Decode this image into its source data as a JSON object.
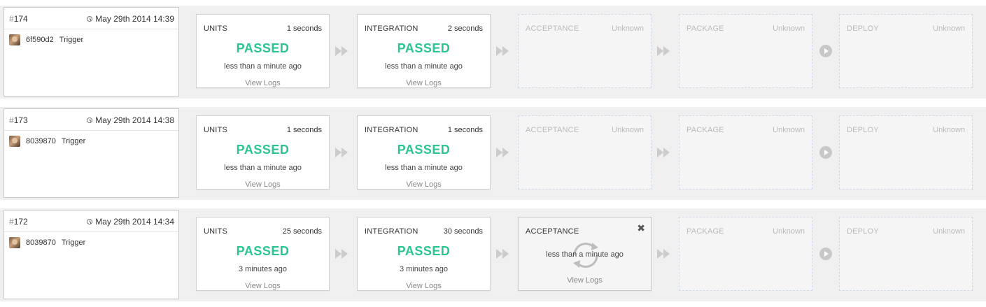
{
  "colors": {
    "passed": "#2bc58f",
    "connector": "#cccccc",
    "pending_border": "#cfd9e6",
    "row_background": "#f0f0f0"
  },
  "builds": [
    {
      "hash_symbol": "#",
      "number": "174",
      "date": "May 29th 2014 14:39",
      "commit": "6f590d2",
      "trigger": "Trigger",
      "stages": [
        {
          "name": "UNITS",
          "duration": "1 seconds",
          "status": "PASSED",
          "time": "less than a minute ago",
          "logs": "View Logs",
          "state": "passed"
        },
        {
          "name": "INTEGRATION",
          "duration": "2 seconds",
          "status": "PASSED",
          "time": "less than a minute ago",
          "logs": "View Logs",
          "state": "passed"
        },
        {
          "name": "ACCEPTANCE",
          "duration": "Unknown",
          "state": "pending"
        },
        {
          "name": "PACKAGE",
          "duration": "Unknown",
          "state": "pending"
        },
        {
          "name": "DEPLOY",
          "duration": "Unknown",
          "state": "pending"
        }
      ]
    },
    {
      "hash_symbol": "#",
      "number": "173",
      "date": "May 29th 2014 14:38",
      "commit": "8039870",
      "trigger": "Trigger",
      "stages": [
        {
          "name": "UNITS",
          "duration": "1 seconds",
          "status": "PASSED",
          "time": "less than a minute ago",
          "logs": "View Logs",
          "state": "passed"
        },
        {
          "name": "INTEGRATION",
          "duration": "1 seconds",
          "status": "PASSED",
          "time": "less than a minute ago",
          "logs": "View Logs",
          "state": "passed"
        },
        {
          "name": "ACCEPTANCE",
          "duration": "Unknown",
          "state": "pending"
        },
        {
          "name": "PACKAGE",
          "duration": "Unknown",
          "state": "pending"
        },
        {
          "name": "DEPLOY",
          "duration": "Unknown",
          "state": "pending"
        }
      ]
    },
    {
      "hash_symbol": "#",
      "number": "172",
      "date": "May 29th 2014 14:34",
      "commit": "8039870",
      "trigger": "Trigger",
      "stages": [
        {
          "name": "UNITS",
          "duration": "25 seconds",
          "status": "PASSED",
          "time": "3 minutes ago",
          "logs": "View Logs",
          "state": "passed"
        },
        {
          "name": "INTEGRATION",
          "duration": "30 seconds",
          "status": "PASSED",
          "time": "3 minutes ago",
          "logs": "View Logs",
          "state": "passed"
        },
        {
          "name": "ACCEPTANCE",
          "duration": "",
          "time": "less than a minute ago",
          "logs": "View Logs",
          "state": "running",
          "close": "✖"
        },
        {
          "name": "PACKAGE",
          "duration": "Unknown",
          "state": "pending"
        },
        {
          "name": "DEPLOY",
          "duration": "Unknown",
          "state": "pending"
        }
      ]
    }
  ],
  "icons": {
    "connector_passed": "fast-forward-icon",
    "connector_pending": "fast-forward-icon",
    "connector_manual": "play-icon",
    "running": "refresh-spinner-icon",
    "close": "close-icon",
    "clock": "clock-icon"
  }
}
